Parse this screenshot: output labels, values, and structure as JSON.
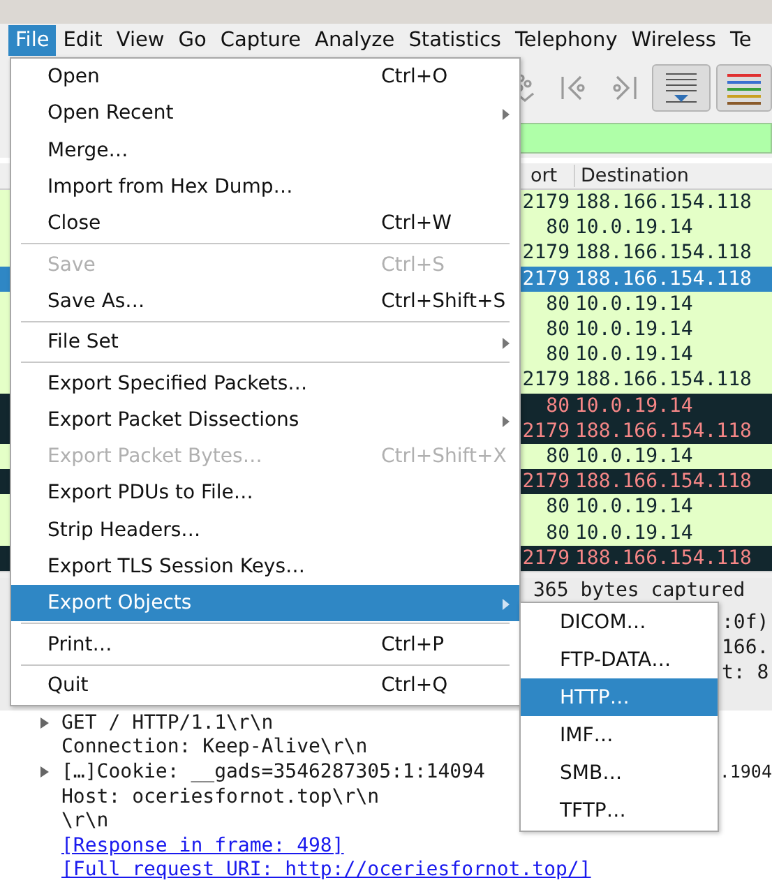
{
  "menubar": [
    {
      "label": "File",
      "selected": true
    },
    {
      "label": "Edit",
      "selected": false
    },
    {
      "label": "View",
      "selected": false
    },
    {
      "label": "Go",
      "selected": false
    },
    {
      "label": "Capture",
      "selected": false
    },
    {
      "label": "Analyze",
      "selected": false
    },
    {
      "label": "Statistics",
      "selected": false
    },
    {
      "label": "Telephony",
      "selected": false
    },
    {
      "label": "Wireless",
      "selected": false
    },
    {
      "label": "Te",
      "selected": false
    }
  ],
  "toolbar": [
    {
      "kind": "jump",
      "pressed": false
    },
    {
      "kind": "first",
      "pressed": false
    },
    {
      "kind": "last",
      "pressed": false
    },
    {
      "kind": "autoscroll",
      "pressed": true
    },
    {
      "kind": "colorize",
      "pressed": true
    }
  ],
  "packet_list": {
    "columns": [
      "ort",
      "Destination"
    ],
    "rows": [
      {
        "port": "2179",
        "destination": "188.166.154.118",
        "kind": "normal",
        "selected": false
      },
      {
        "port": "80",
        "destination": "10.0.19.14",
        "kind": "normal",
        "selected": false
      },
      {
        "port": "2179",
        "destination": "188.166.154.118",
        "kind": "normal",
        "selected": false
      },
      {
        "port": "2179",
        "destination": "188.166.154.118",
        "kind": "normal",
        "selected": true
      },
      {
        "port": "80",
        "destination": "10.0.19.14",
        "kind": "normal",
        "selected": false
      },
      {
        "port": "80",
        "destination": "10.0.19.14",
        "kind": "normal",
        "selected": false
      },
      {
        "port": "80",
        "destination": "10.0.19.14",
        "kind": "normal",
        "selected": false
      },
      {
        "port": "2179",
        "destination": "188.166.154.118",
        "kind": "normal",
        "selected": false
      },
      {
        "port": "80",
        "destination": "10.0.19.14",
        "kind": "error",
        "selected": false
      },
      {
        "port": "2179",
        "destination": "188.166.154.118",
        "kind": "error",
        "selected": false
      },
      {
        "port": "80",
        "destination": "10.0.19.14",
        "kind": "normal",
        "selected": false
      },
      {
        "port": "2179",
        "destination": "188.166.154.118",
        "kind": "error",
        "selected": false
      },
      {
        "port": "80",
        "destination": "10.0.19.14",
        "kind": "normal",
        "selected": false
      },
      {
        "port": "80",
        "destination": "10.0.19.14",
        "kind": "normal",
        "selected": false
      },
      {
        "port": "2179",
        "destination": "188.166.154.118",
        "kind": "error",
        "selected": false
      }
    ]
  },
  "details": {
    "partial_lines": [
      "365 bytes captured",
      ":0f)",
      "166.",
      "t: 8"
    ],
    "tree": [
      {
        "kind": "node",
        "expanded": false,
        "text": "GET / HTTP/1.1\\r\\n"
      },
      {
        "kind": "leaf",
        "text": "Connection: Keep-Alive\\r\\n"
      },
      {
        "kind": "split",
        "expanded": false,
        "text": "[…]Cookie: __gads=3546287305:1:14094",
        "tail": ".1904"
      },
      {
        "kind": "leaf",
        "text": "Host: oceriesfornot.top\\r\\n"
      },
      {
        "kind": "leaf",
        "text": "\\r\\n"
      },
      {
        "kind": "link",
        "text": "[Response in frame: 498]"
      },
      {
        "kind": "link",
        "text": "[Full request URI: http://oceriesfornot.top/]"
      }
    ]
  },
  "file_menu": [
    {
      "kind": "item",
      "label": "Open",
      "shortcut": "Ctrl+O",
      "disabled": false,
      "submenu": false,
      "selected": false
    },
    {
      "kind": "item",
      "label": "Open Recent",
      "disabled": false,
      "submenu": true,
      "selected": false
    },
    {
      "kind": "item",
      "label": "Merge…",
      "disabled": false,
      "submenu": false,
      "selected": false
    },
    {
      "kind": "item",
      "label": "Import from Hex Dump…",
      "disabled": false,
      "submenu": false,
      "selected": false
    },
    {
      "kind": "item",
      "label": "Close",
      "shortcut": "Ctrl+W",
      "disabled": false,
      "submenu": false,
      "selected": false
    },
    {
      "kind": "separator"
    },
    {
      "kind": "item",
      "label": "Save",
      "shortcut": "Ctrl+S",
      "disabled": true,
      "submenu": false,
      "selected": false
    },
    {
      "kind": "item",
      "label": "Save As…",
      "shortcut": "Ctrl+Shift+S",
      "disabled": false,
      "submenu": false,
      "selected": false
    },
    {
      "kind": "separator"
    },
    {
      "kind": "item",
      "label": "File Set",
      "disabled": false,
      "submenu": true,
      "selected": false
    },
    {
      "kind": "separator"
    },
    {
      "kind": "item",
      "label": "Export Specified Packets…",
      "disabled": false,
      "submenu": false,
      "selected": false
    },
    {
      "kind": "item",
      "label": "Export Packet Dissections",
      "disabled": false,
      "submenu": true,
      "selected": false
    },
    {
      "kind": "item",
      "label": "Export Packet Bytes…",
      "shortcut": "Ctrl+Shift+X",
      "disabled": true,
      "submenu": false,
      "selected": false
    },
    {
      "kind": "item",
      "label": "Export PDUs to File…",
      "disabled": false,
      "submenu": false,
      "selected": false
    },
    {
      "kind": "item",
      "label": "Strip Headers…",
      "disabled": false,
      "submenu": false,
      "selected": false
    },
    {
      "kind": "item",
      "label": "Export TLS Session Keys…",
      "disabled": false,
      "submenu": false,
      "selected": false
    },
    {
      "kind": "item",
      "label": "Export Objects",
      "disabled": false,
      "submenu": true,
      "selected": true
    },
    {
      "kind": "separator"
    },
    {
      "kind": "item",
      "label": "Print…",
      "shortcut": "Ctrl+P",
      "disabled": false,
      "submenu": false,
      "selected": false
    },
    {
      "kind": "separator"
    },
    {
      "kind": "item",
      "label": "Quit",
      "shortcut": "Ctrl+Q",
      "disabled": false,
      "submenu": false,
      "selected": false
    }
  ],
  "export_objects_menu": [
    {
      "label": "DICOM…",
      "selected": false
    },
    {
      "label": "FTP-DATA…",
      "selected": false
    },
    {
      "label": "HTTP…",
      "selected": true
    },
    {
      "label": "IMF…",
      "selected": false
    },
    {
      "label": "SMB…",
      "selected": false
    },
    {
      "label": "TFTP…",
      "selected": false
    }
  ]
}
